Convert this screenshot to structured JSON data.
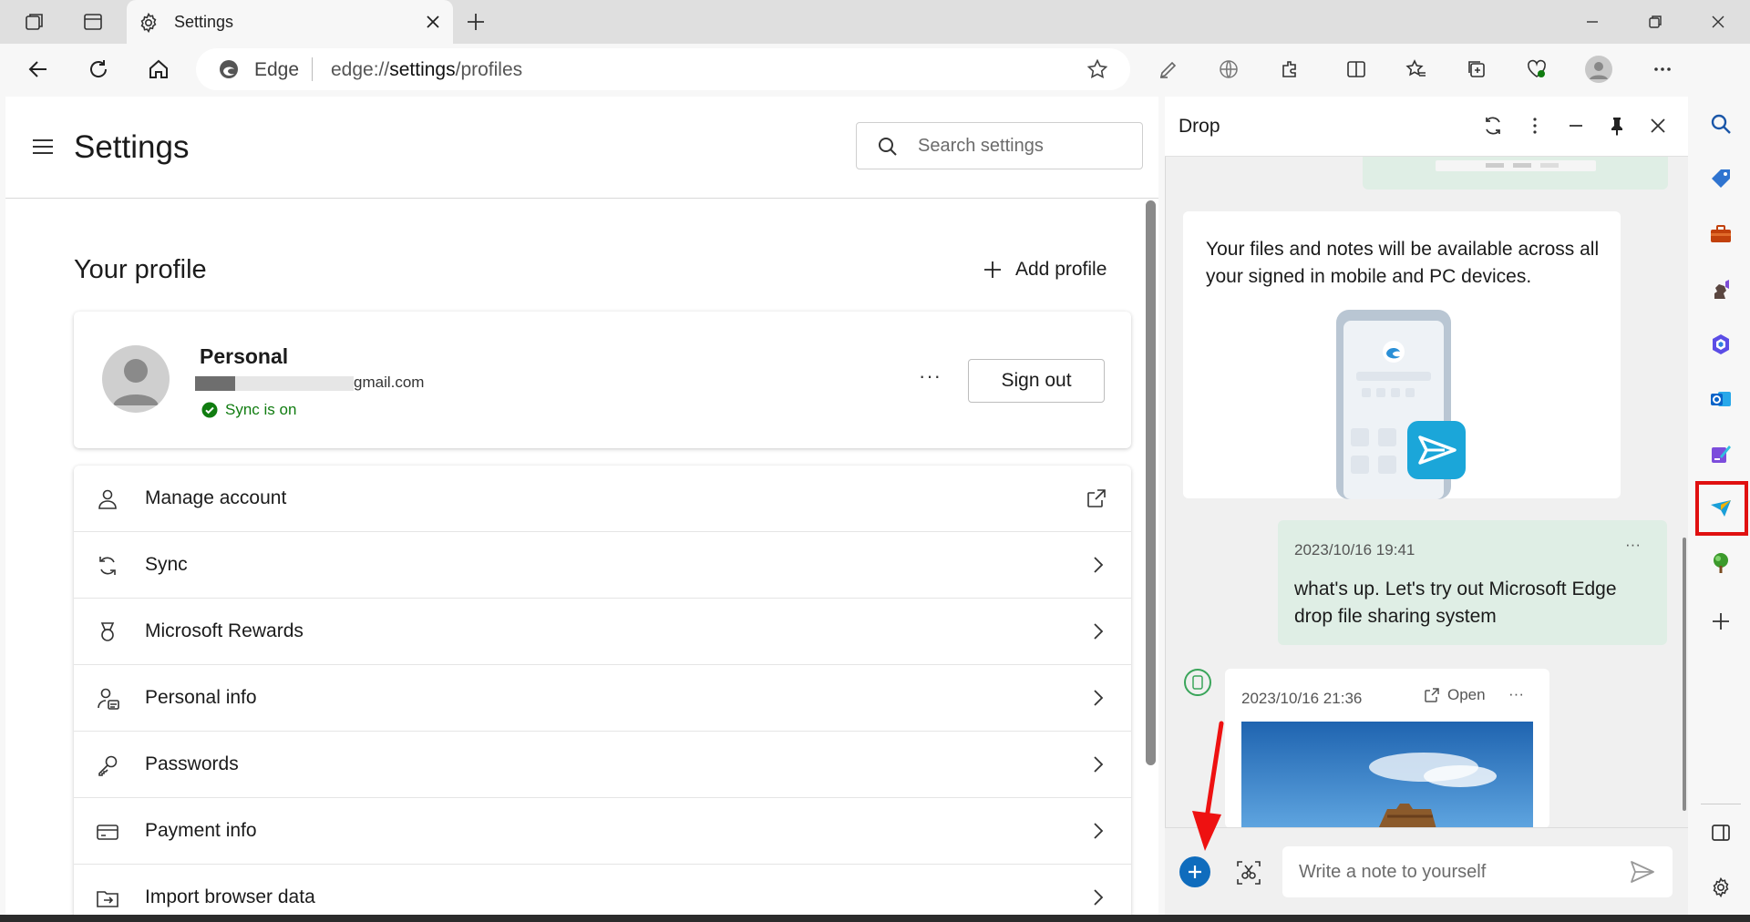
{
  "browser": {
    "tab_title": "Settings",
    "address": {
      "site_label": "Edge",
      "url_prefix": "edge://",
      "url_bold": "settings",
      "url_suffix": "/profiles"
    }
  },
  "settings": {
    "title": "Settings",
    "search_placeholder": "Search settings",
    "profile_heading": "Your profile",
    "add_profile_label": "Add profile",
    "profile": {
      "name": "Personal",
      "email_visible": "gmail.com",
      "sync_status": "Sync is on",
      "more_label": "···",
      "sign_out_label": "Sign out"
    },
    "menu": [
      {
        "label": "Manage account",
        "icon": "person-icon",
        "trail": "external-link-icon"
      },
      {
        "label": "Sync",
        "icon": "sync-icon",
        "trail": "chevron-right-icon"
      },
      {
        "label": "Microsoft Rewards",
        "icon": "rewards-icon",
        "trail": "chevron-right-icon"
      },
      {
        "label": "Personal info",
        "icon": "personal-info-icon",
        "trail": "chevron-right-icon"
      },
      {
        "label": "Passwords",
        "icon": "key-icon",
        "trail": "chevron-right-icon"
      },
      {
        "label": "Payment info",
        "icon": "card-icon",
        "trail": "chevron-right-icon"
      },
      {
        "label": "Import browser data",
        "icon": "import-icon",
        "trail": "chevron-right-icon"
      }
    ]
  },
  "drop": {
    "title": "Drop",
    "info_text": "Your files and notes will be available across all your signed in mobile and PC devices.",
    "messages": [
      {
        "timestamp": "2023/10/16 19:41",
        "text": "what's up. Let's try out Microsoft Edge drop file sharing system",
        "more": "···"
      },
      {
        "timestamp": "2023/10/16 21:36",
        "open_label": "Open",
        "more": "···"
      }
    ],
    "note_placeholder": "Write a note to yourself"
  },
  "colors": {
    "accent": "#0f6cbd",
    "sync_green": "#107c10",
    "highlight_red": "#e01010",
    "message_bubble": "#dfeee5"
  }
}
